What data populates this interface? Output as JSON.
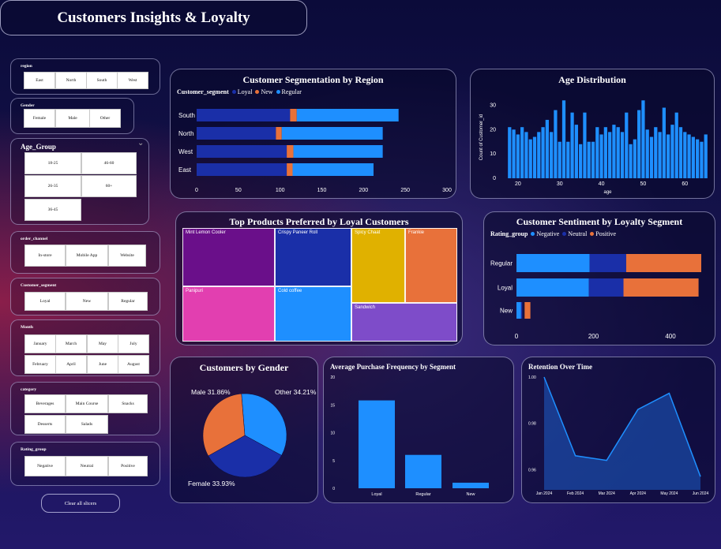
{
  "header": {
    "title": "Customers Insights & Loyalty"
  },
  "slicers": {
    "region": {
      "label": "region",
      "options": [
        "East",
        "North",
        "South",
        "West"
      ]
    },
    "gender": {
      "label": "Gender",
      "options": [
        "Female",
        "Male",
        "Other"
      ]
    },
    "age_group": {
      "label": "Age_Group",
      "options": [
        "18-25",
        "46-60",
        "26-35",
        "60+",
        "36-45"
      ]
    },
    "order_channel": {
      "label": "order_channel",
      "options": [
        "In-store",
        "Mobile App",
        "Website"
      ]
    },
    "customer_segment": {
      "label": "Customer_segment",
      "options": [
        "Loyal",
        "New",
        "Regular"
      ]
    },
    "month": {
      "label": "Month",
      "options": [
        "January",
        "March",
        "May",
        "July",
        "February",
        "April",
        "June",
        "August"
      ]
    },
    "category": {
      "label": "category",
      "options": [
        "Beverages",
        "Main Course",
        "Snacks",
        "Desserts",
        "Salads"
      ]
    },
    "rating_group": {
      "label": "Rating_group",
      "options": [
        "Negative",
        "Neutral",
        "Positive"
      ]
    },
    "clear_label": "Clear all slicers"
  },
  "colors": {
    "loyal": "#1a2fa8",
    "new": "#e8713a",
    "regular": "#1e8fff",
    "negative": "#1e8fff",
    "neutral": "#1a2fa8",
    "positive": "#e8713a"
  },
  "chart_data": [
    {
      "id": "segmentation",
      "type": "bar",
      "orientation": "horizontal",
      "stacked": true,
      "title": "Customer Segmentation by Region",
      "legend_title": "Customer_segment",
      "categories": [
        "South",
        "North",
        "West",
        "East"
      ],
      "series": [
        {
          "name": "Loyal",
          "values": [
            112,
            95,
            108,
            108
          ]
        },
        {
          "name": "New",
          "values": [
            8,
            7,
            8,
            7
          ]
        },
        {
          "name": "Regular",
          "values": [
            122,
            121,
            107,
            97
          ]
        }
      ],
      "xlim": [
        0,
        300
      ],
      "xticks": [
        "0",
        "50",
        "100",
        "150",
        "200",
        "250",
        "300"
      ]
    },
    {
      "id": "age",
      "type": "bar",
      "title": "Age Distribution",
      "xlabel": "age",
      "ylabel": "Count of Customer_id",
      "x": [
        18,
        19,
        20,
        21,
        22,
        23,
        24,
        25,
        26,
        27,
        28,
        29,
        30,
        31,
        32,
        33,
        34,
        35,
        36,
        37,
        38,
        39,
        40,
        41,
        42,
        43,
        44,
        45,
        46,
        47,
        48,
        49,
        50,
        51,
        52,
        53,
        54,
        55,
        56,
        57,
        58,
        59,
        60,
        61,
        62,
        63,
        64,
        65
      ],
      "values": [
        21,
        20,
        18,
        21,
        19,
        16,
        17,
        19,
        21,
        24,
        19,
        28,
        15,
        32,
        15,
        27,
        22,
        14,
        27,
        15,
        15,
        21,
        18,
        21,
        19,
        22,
        21,
        19,
        27,
        14,
        16,
        28,
        32,
        20,
        17,
        21,
        19,
        29,
        18,
        22,
        27,
        21,
        19,
        18,
        17,
        16,
        15,
        18
      ],
      "ylim": [
        0,
        35
      ],
      "yticks": [
        "0",
        "10",
        "20",
        "30"
      ],
      "xticks": [
        "20",
        "30",
        "40",
        "50",
        "60"
      ]
    },
    {
      "id": "treemap",
      "type": "treemap",
      "title": "Top Products Preferred by Loyal Customers",
      "items": [
        {
          "name": "Mint Lemon Cooler",
          "color": "#6a0f8a"
        },
        {
          "name": "Crispy Paneer Roll",
          "color": "#1a2fa8"
        },
        {
          "name": "Spicy Chaat",
          "color": "#e0b100"
        },
        {
          "name": "Frankie",
          "color": "#e8713a"
        },
        {
          "name": "Panipuri",
          "color": "#e23fb0"
        },
        {
          "name": "Cold coffee",
          "color": "#1e8fff"
        },
        {
          "name": "Sandwich",
          "color": "#7e4cc9"
        }
      ]
    },
    {
      "id": "sentiment",
      "type": "bar",
      "orientation": "horizontal",
      "stacked": true,
      "title": "Customer Sentiment by Loyalty Segment",
      "legend_title": "Rating_group",
      "categories": [
        "Regular",
        "Loyal",
        "New"
      ],
      "series": [
        {
          "name": "Negative",
          "values": [
            190,
            188,
            12
          ]
        },
        {
          "name": "Neutral",
          "values": [
            95,
            90,
            3
          ]
        },
        {
          "name": "Positive",
          "values": [
            195,
            195,
            15
          ]
        }
      ],
      "xlim": [
        0,
        480
      ],
      "xticks": [
        "0",
        "200",
        "400"
      ]
    },
    {
      "id": "gender",
      "type": "pie",
      "donut": false,
      "title": "Customers by Gender",
      "slices": [
        {
          "name": "Other",
          "value": 34.21,
          "label": "Other 34.21%"
        },
        {
          "name": "Female",
          "value": 33.93,
          "label": "Female 33.93%"
        },
        {
          "name": "Male",
          "value": 31.86,
          "label": "Male 31.86%"
        }
      ]
    },
    {
      "id": "frequency",
      "type": "bar",
      "title": "Average Purchase Frequency by Segment",
      "categories": [
        "Loyal",
        "Regular",
        "New"
      ],
      "values": [
        15.8,
        6,
        1
      ],
      "ylim": [
        0,
        20
      ],
      "yticks": [
        "0",
        "5",
        "10",
        "15",
        "20"
      ]
    },
    {
      "id": "retention",
      "type": "area",
      "title": "Retention Over Time",
      "categories": [
        "Jan 2024",
        "Feb 2024",
        "Mar 2024",
        "Apr 2024",
        "May 2024",
        "Jun 2024"
      ],
      "values": [
        1.0,
        0.966,
        0.964,
        0.986,
        0.993,
        0.957
      ],
      "ylim": [
        0.954,
        1.0
      ],
      "yticks": [
        "1.00",
        "0.98",
        "0.96"
      ]
    }
  ]
}
